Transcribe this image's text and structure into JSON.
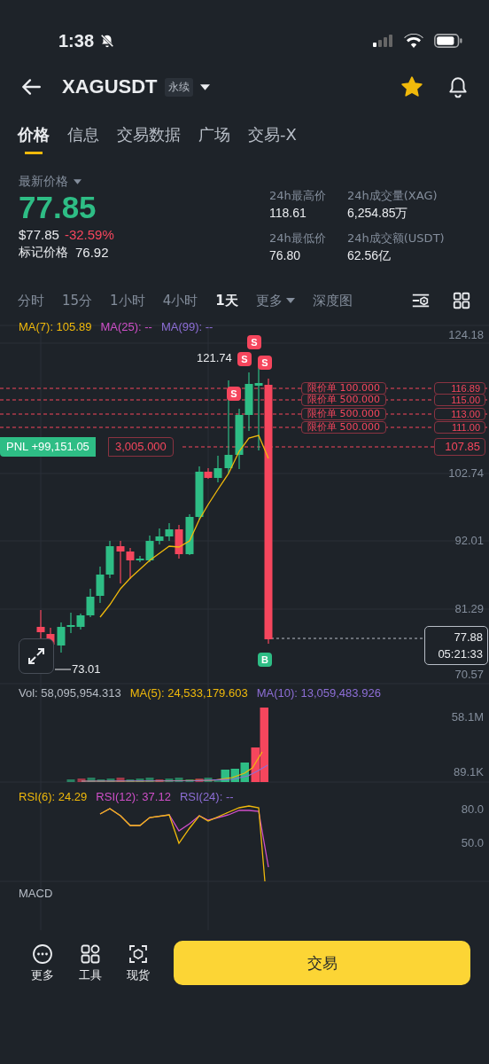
{
  "status_bar": {
    "time": "1:38"
  },
  "header": {
    "symbol": "XAGUSDT",
    "badge": "永续",
    "favorite": true
  },
  "tabs": [
    {
      "label": "价格",
      "selected": true
    },
    {
      "label": "信息",
      "selected": false
    },
    {
      "label": "交易数据",
      "selected": false
    },
    {
      "label": "广场",
      "selected": false
    },
    {
      "label": "交易-X",
      "selected": false
    }
  ],
  "price": {
    "label": "最新价格",
    "last": "77.85",
    "usd": "$77.85",
    "change": "-32.59%",
    "mark_label": "标记价格",
    "mark": "76.92"
  },
  "stats": [
    {
      "label": "24h最高价",
      "value": "118.61"
    },
    {
      "label": "24h成交量(XAG)",
      "value": "6,254.85万"
    },
    {
      "label": "24h最低价",
      "value": "76.80"
    },
    {
      "label": "24h成交额(USDT)",
      "value": "62.56亿"
    }
  ],
  "intervals": [
    {
      "label": "分时",
      "selected": false,
      "kind": "plain"
    },
    {
      "label": "15分",
      "selected": false,
      "kind": "plain"
    },
    {
      "label": "1小时",
      "selected": false,
      "kind": "plain"
    },
    {
      "label": "4小时",
      "selected": false,
      "kind": "plain"
    },
    {
      "label": "1天",
      "selected": true,
      "kind": "plain"
    },
    {
      "label": "更多",
      "selected": false,
      "kind": "dropdown"
    },
    {
      "label": "深度图",
      "selected": false,
      "kind": "plain"
    }
  ],
  "chart": {
    "indicators": [
      {
        "label": "MA(7): 105.89",
        "color": "#f0b90b"
      },
      {
        "label": "MA(25): --",
        "color": "#d04fc9"
      },
      {
        "label": "MA(99): --",
        "color": "#8d6ed6"
      }
    ],
    "axis_labels": [
      "124.18",
      "102.74",
      "92.01",
      "81.29",
      "70.57"
    ],
    "high_label": "121.74",
    "low_label": "73.01",
    "orders": [
      {
        "label": "限价单 100.000",
        "price": "116.89"
      },
      {
        "label": "限价单 500.000",
        "price": "115.00"
      },
      {
        "label": "限价单 500.000",
        "price": "113.00"
      },
      {
        "label": "限价单 500.000",
        "price": "111.00"
      }
    ],
    "position": {
      "pnl": "PNL +99,151.05",
      "size": "3,005.000",
      "price": "107.85"
    },
    "last_price": {
      "price": "77.88",
      "countdown": "05:21:33"
    },
    "markers": [
      {
        "text": "S",
        "kind": "sell"
      },
      {
        "text": "S",
        "kind": "sell"
      },
      {
        "text": "S",
        "kind": "sell"
      },
      {
        "text": "S",
        "kind": "sell"
      },
      {
        "text": "B",
        "kind": "buy"
      }
    ]
  },
  "volume": {
    "indicators": [
      {
        "label": "Vol: 58,095,954.313",
        "color": "#b7bdc6"
      },
      {
        "label": "MA(5): 24,533,179.603",
        "color": "#f0b90b"
      },
      {
        "label": "MA(10): 13,059,483.926",
        "color": "#8d6ed6"
      }
    ],
    "axis_labels": [
      "58.1M",
      "89.1K"
    ]
  },
  "rsi": {
    "indicators": [
      {
        "label": "RSI(6): 24.29",
        "color": "#f0b90b"
      },
      {
        "label": "RSI(12): 37.12",
        "color": "#d04fc9"
      },
      {
        "label": "RSI(24): --",
        "color": "#8d6ed6"
      }
    ],
    "axis_labels": [
      "80.0",
      "50.0"
    ]
  },
  "macd": {
    "label": "MACD"
  },
  "bottom_bar": {
    "items": [
      {
        "label": "更多",
        "kind": "more"
      },
      {
        "label": "工具",
        "kind": "tools"
      },
      {
        "label": "现货",
        "kind": "spot"
      }
    ],
    "trade_button": "交易"
  }
}
